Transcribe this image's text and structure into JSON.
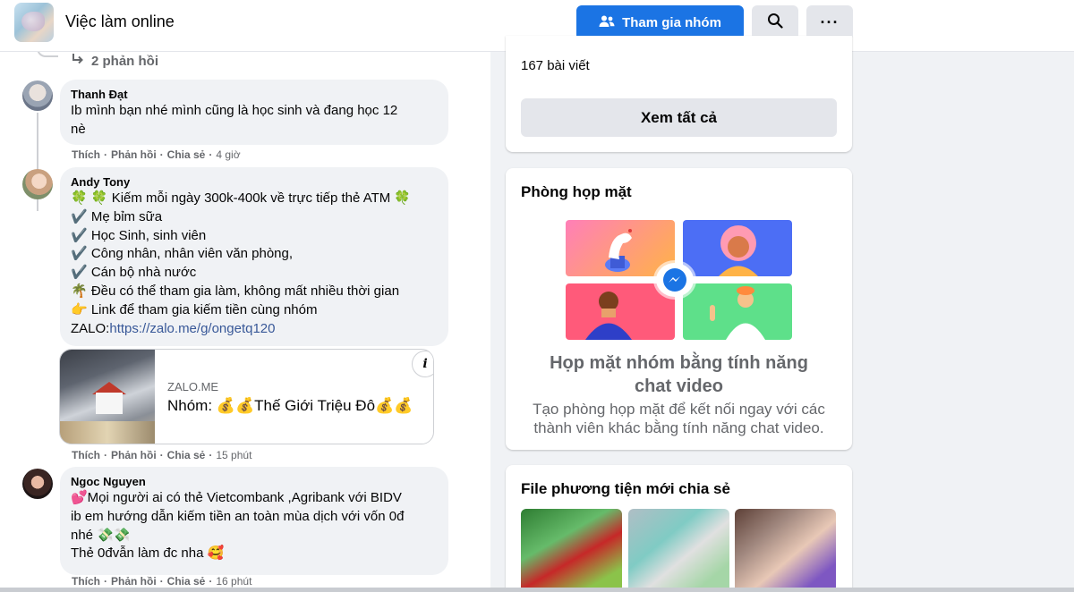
{
  "header": {
    "group_name": "Việc làm online",
    "join_label": "Tham gia nhóm",
    "more_label": "···"
  },
  "comments": {
    "replies_label": "2 phản hồi",
    "items": [
      {
        "author": "Thanh Đạt",
        "text": "Ib mình bạn nhé mình cũng là học sinh và đang học 12\nnè",
        "like": "Thích",
        "reply": "Phản hồi",
        "share": "Chia sẻ",
        "time": "4 giờ"
      },
      {
        "author": "Andy Tony",
        "lines": [
          "🍀 🍀 Kiếm mỗi ngày 300k-400k về trực tiếp thẻ ATM 🍀",
          "✔️ Mẹ bỉm sữa",
          "✔️ Học Sinh, sinh viên",
          "✔️ Công nhân, nhân viên văn phòng,",
          "✔️ Cán bộ nhà nước",
          "🌴 Đều có thể tham gia làm, không mất nhiều thời gian",
          "👉 Link để tham gia kiếm tiền cùng nhóm"
        ],
        "zalo_prefix": "ZALO:",
        "zalo_link": "https://zalo.me/g/ongetq120",
        "card_domain": "ZALO.ME",
        "card_title": "Nhóm: 💰💰Thế Giới Triệu Đô💰💰",
        "like": "Thích",
        "reply": "Phản hồi",
        "share": "Chia sẻ",
        "time": "15 phút"
      },
      {
        "author": "Ngoc Nguyen",
        "text": "💕Mọi người ai có thẻ Vietcombank ,Agribank với BIDV\nib em hướng dẫn kiếm tiền an toàn mùa dịch với vốn 0đ\nnhé 💸💸\nThẻ 0đvẫn làm đc nha 🥰",
        "like": "Thích",
        "reply": "Phản hồi",
        "share": "Chia sẻ",
        "time": "16 phút"
      }
    ]
  },
  "sidebar": {
    "posts_count": "167 bài viết",
    "see_all": "Xem tất cả",
    "room_heading": "Phòng họp mặt",
    "room_title": "Họp mặt nhóm bằng tính năng\nchat video",
    "room_desc": "Tạo phòng họp mặt để kết nối ngay với các\nthành viên khác bằng tính năng chat video.",
    "media_heading": "File phương tiện mới chia sẻ"
  },
  "colors": {
    "primary": "#1b74e4",
    "link": "#385898",
    "secondary_text": "#65676b",
    "background": "#f0f2f5"
  }
}
